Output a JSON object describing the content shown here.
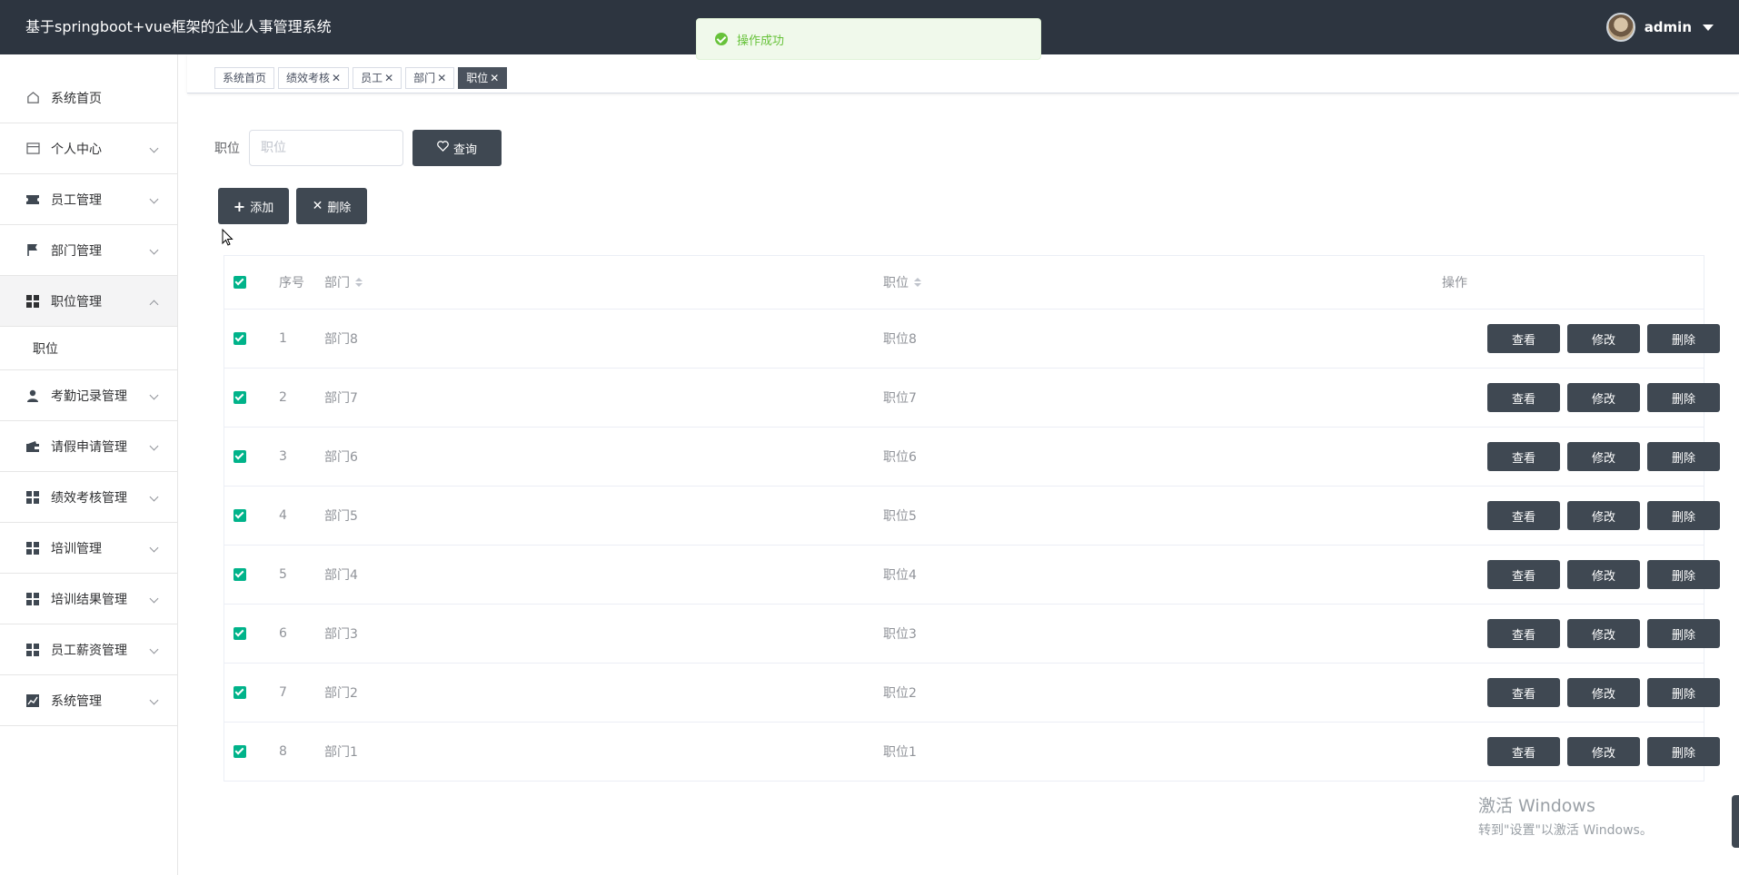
{
  "header": {
    "app_title": "基于springboot+vue框架的企业人事管理系统",
    "user_name": "admin"
  },
  "toast": {
    "message": "操作成功",
    "type": "success"
  },
  "sidebar": {
    "items": [
      {
        "label": "系统首页",
        "icon": "home-icon"
      },
      {
        "label": "个人中心",
        "icon": "card-icon"
      },
      {
        "label": "员工管理",
        "icon": "ticket-icon"
      },
      {
        "label": "部门管理",
        "icon": "flag-icon"
      },
      {
        "label": "职位管理",
        "icon": "grid-icon",
        "expanded": true,
        "children": [
          {
            "label": "职位"
          }
        ]
      },
      {
        "label": "考勤记录管理",
        "icon": "user-icon"
      },
      {
        "label": "请假申请管理",
        "icon": "wallet-icon"
      },
      {
        "label": "绩效考核管理",
        "icon": "grid-icon"
      },
      {
        "label": "培训管理",
        "icon": "grid-icon"
      },
      {
        "label": "培训结果管理",
        "icon": "grid-icon"
      },
      {
        "label": "员工薪资管理",
        "icon": "grid-icon"
      },
      {
        "label": "系统管理",
        "icon": "chart-icon"
      }
    ]
  },
  "tabs": [
    {
      "label": "系统首页",
      "closable": false
    },
    {
      "label": "绩效考核",
      "closable": true
    },
    {
      "label": "员工",
      "closable": true
    },
    {
      "label": "部门",
      "closable": true
    },
    {
      "label": "职位",
      "closable": true,
      "active": true
    }
  ],
  "search": {
    "label": "职位",
    "placeholder": "职位",
    "button_label": "查询"
  },
  "actions": {
    "add_label": "添加",
    "delete_label": "删除"
  },
  "table": {
    "columns": {
      "index": "序号",
      "department": "部门",
      "position": "职位",
      "operations": "操作"
    },
    "row_buttons": {
      "view": "查看",
      "edit": "修改",
      "delete": "删除"
    },
    "rows": [
      {
        "index": "1",
        "department": "部门8",
        "position": "职位8",
        "checked": true
      },
      {
        "index": "2",
        "department": "部门7",
        "position": "职位7",
        "checked": true
      },
      {
        "index": "3",
        "department": "部门6",
        "position": "职位6",
        "checked": true
      },
      {
        "index": "4",
        "department": "部门5",
        "position": "职位5",
        "checked": true
      },
      {
        "index": "5",
        "department": "部门4",
        "position": "职位4",
        "checked": true
      },
      {
        "index": "6",
        "department": "部门3",
        "position": "职位3",
        "checked": true
      },
      {
        "index": "7",
        "department": "部门2",
        "position": "职位2",
        "checked": true
      },
      {
        "index": "8",
        "department": "部门1",
        "position": "职位1",
        "checked": true
      }
    ]
  },
  "watermark": {
    "title": "激活 Windows",
    "subtitle": "转到\"设置\"以激活 Windows。"
  },
  "colors": {
    "header_bg": "#2d3540",
    "button_bg": "#3f4852",
    "checkbox": "#00b38a",
    "toast_text": "#67c23a"
  }
}
